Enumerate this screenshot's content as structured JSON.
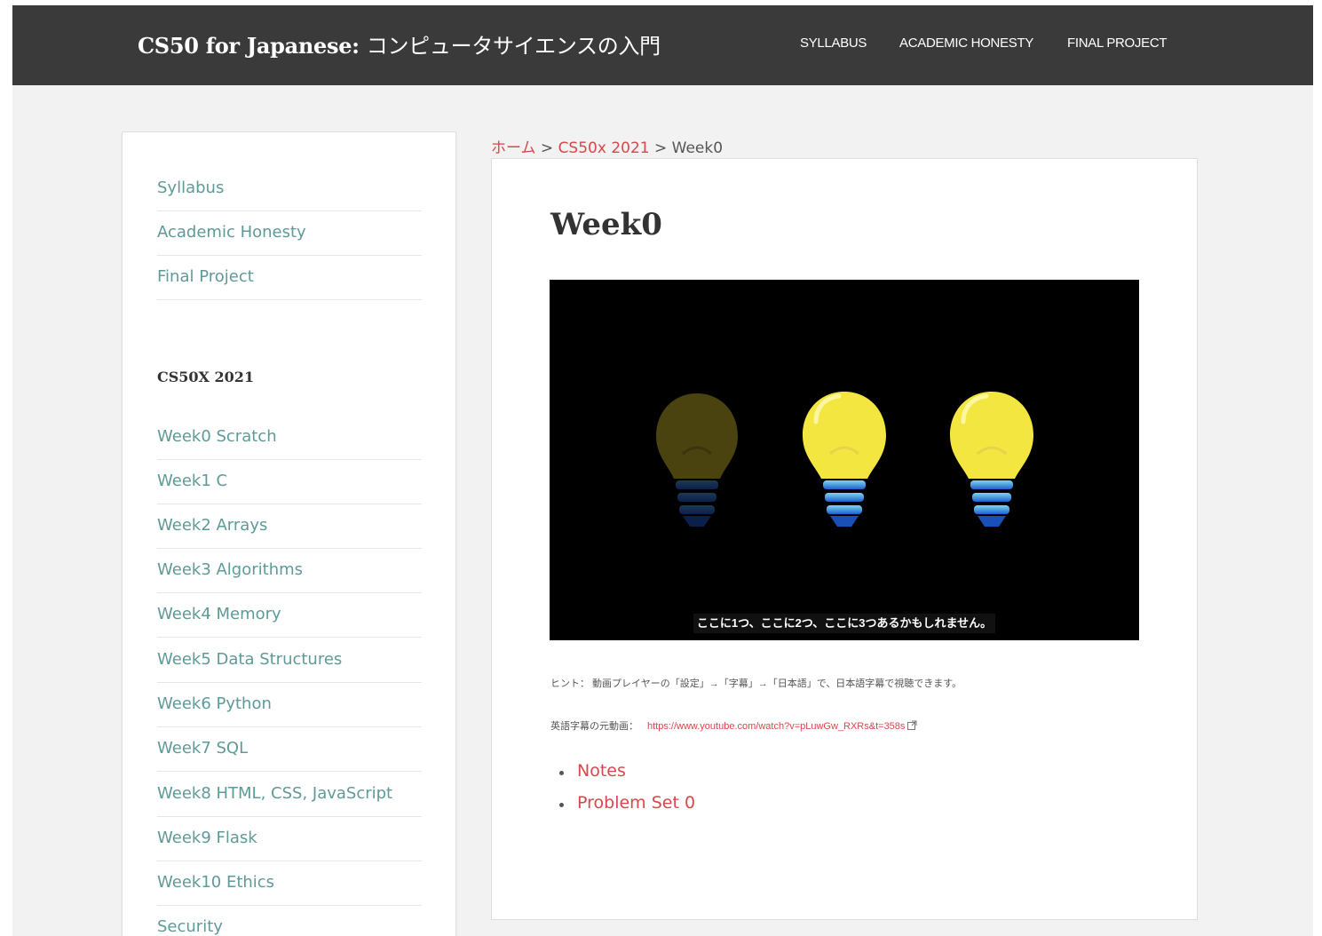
{
  "header": {
    "title_en": "CS50 for Japanese:",
    "title_jp": "コンピュータサイエンスの入門",
    "nav": [
      "SYLLABUS",
      "ACADEMIC HONESTY",
      "FINAL PROJECT"
    ]
  },
  "sidebar": {
    "top_links": [
      "Syllabus",
      "Academic Honesty",
      "Final Project"
    ],
    "heading": "CS50X 2021",
    "week_links": [
      "Week0 Scratch",
      "Week1 C",
      "Week2 Arrays",
      "Week3 Algorithms",
      "Week4 Memory",
      "Week5 Data Structures",
      "Week6 Python",
      "Week7 SQL",
      "Week8 HTML, CSS, JavaScript",
      "Week9 Flask",
      "Week10 Ethics",
      "Security"
    ]
  },
  "breadcrumb": {
    "home": "ホーム",
    "sep1": " > ",
    "parent": "CS50x 2021",
    "sep2": " > ",
    "current": "Week0"
  },
  "main": {
    "title": "Week0",
    "video_caption": "ここに1つ、ここに2つ、ここに3つあるかもしれません。",
    "hint": "ヒント：  動画プレイヤーの「設定」→「字幕」→「日本語」で、日本語字幕で視聴できます。",
    "source_label": "英語字幕の元動画：",
    "source_url": "https://www.youtube.com/watch?v=pLuwGw_RXRs&t=358s",
    "links": [
      "Notes",
      "Problem Set 0"
    ]
  },
  "colors": {
    "header_bg": "#3a3a3a",
    "page_bg": "#f2f2f2",
    "sidebar_link": "#5e9a98",
    "accent_link": "#d8474b",
    "bulb_on": "#f4e640",
    "bulb_off": "#4a4310"
  }
}
